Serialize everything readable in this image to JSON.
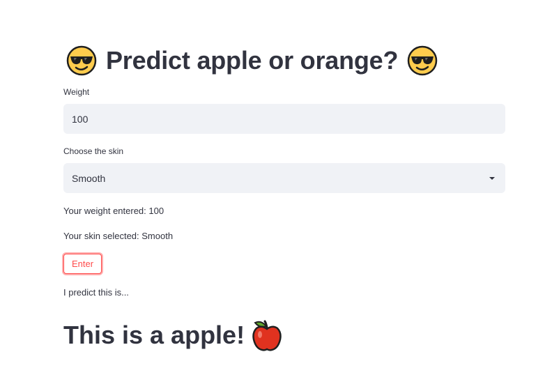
{
  "title": {
    "text": "Predict apple or orange?",
    "emoji_icon": "sunglasses-face-icon"
  },
  "weight": {
    "label": "Weight",
    "value": "100"
  },
  "skin": {
    "label": "Choose the skin",
    "selected": "Smooth"
  },
  "summary": {
    "weight_line": "Your weight entered: 100",
    "skin_line": "Your skin selected: Smooth"
  },
  "enter_button": {
    "label": "Enter"
  },
  "prediction": {
    "intro": "I predict this is...",
    "result": "This is a apple!",
    "result_icon": "red-apple-icon"
  },
  "colors": {
    "text": "#31333f",
    "accent": "#ff4b4b",
    "field_bg": "#f0f2f6"
  }
}
